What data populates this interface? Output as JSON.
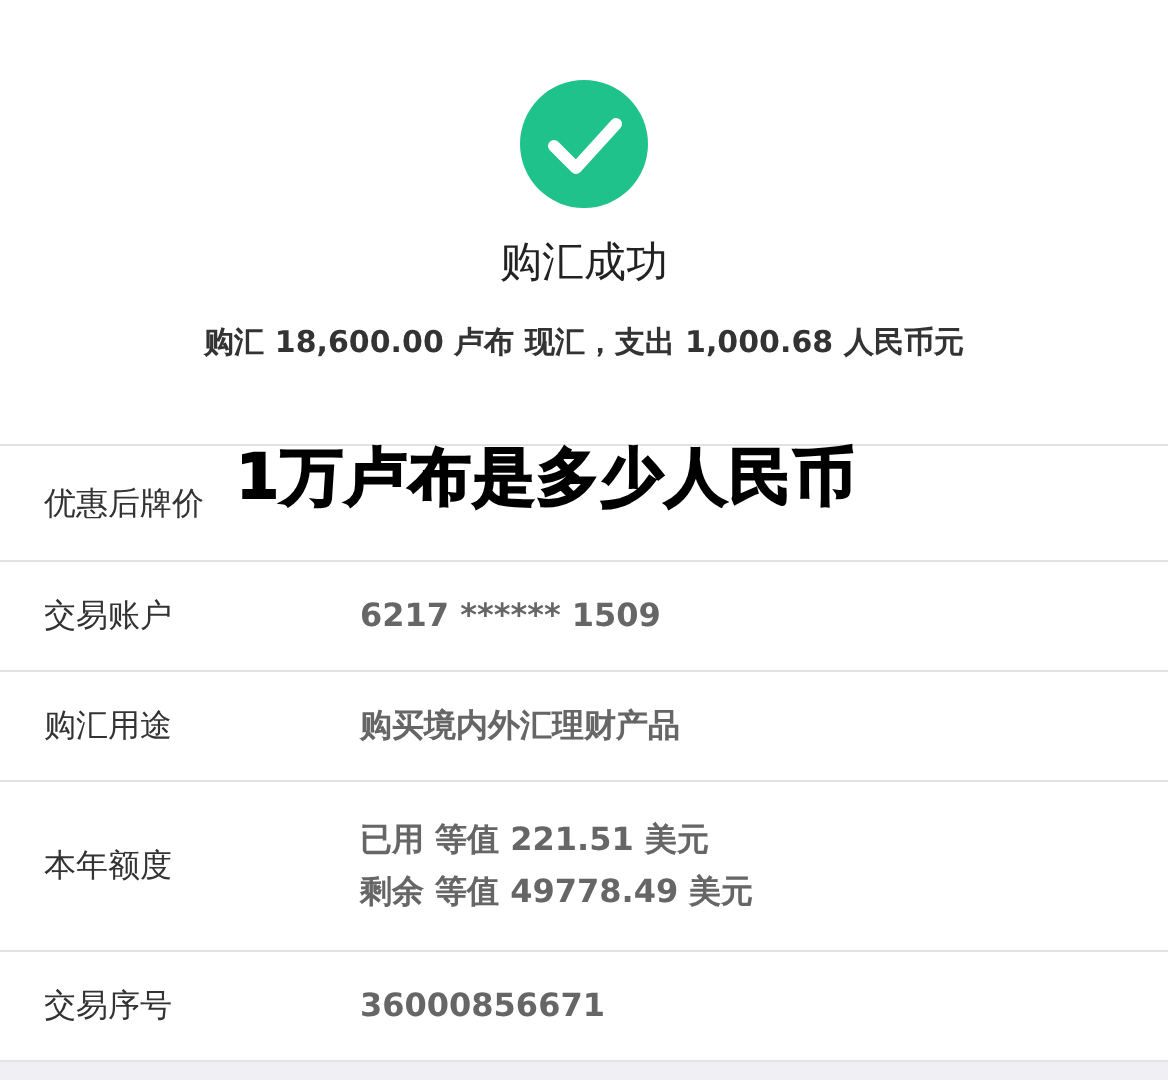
{
  "result": {
    "title": "购汇成功",
    "summary": "购汇 18,600.00 卢布 现汇，支出 1,000.68 人民币元"
  },
  "rows": [
    {
      "label": "优惠后牌价",
      "kind": "covered"
    },
    {
      "label": "交易账户",
      "kind": "text",
      "lines": [
        "6217 ****** 1509"
      ]
    },
    {
      "label": "购汇用途",
      "kind": "text",
      "lines": [
        "购买境内外汇理财产品"
      ]
    },
    {
      "label": "本年额度",
      "kind": "text",
      "lines": [
        "已用 等值 221.51 美元",
        "剩余 等值 49778.49 美元"
      ]
    },
    {
      "label": "交易序号",
      "kind": "text",
      "lines": [
        "36000856671"
      ]
    }
  ],
  "overlay_caption": "1万卢布是多少人民币"
}
